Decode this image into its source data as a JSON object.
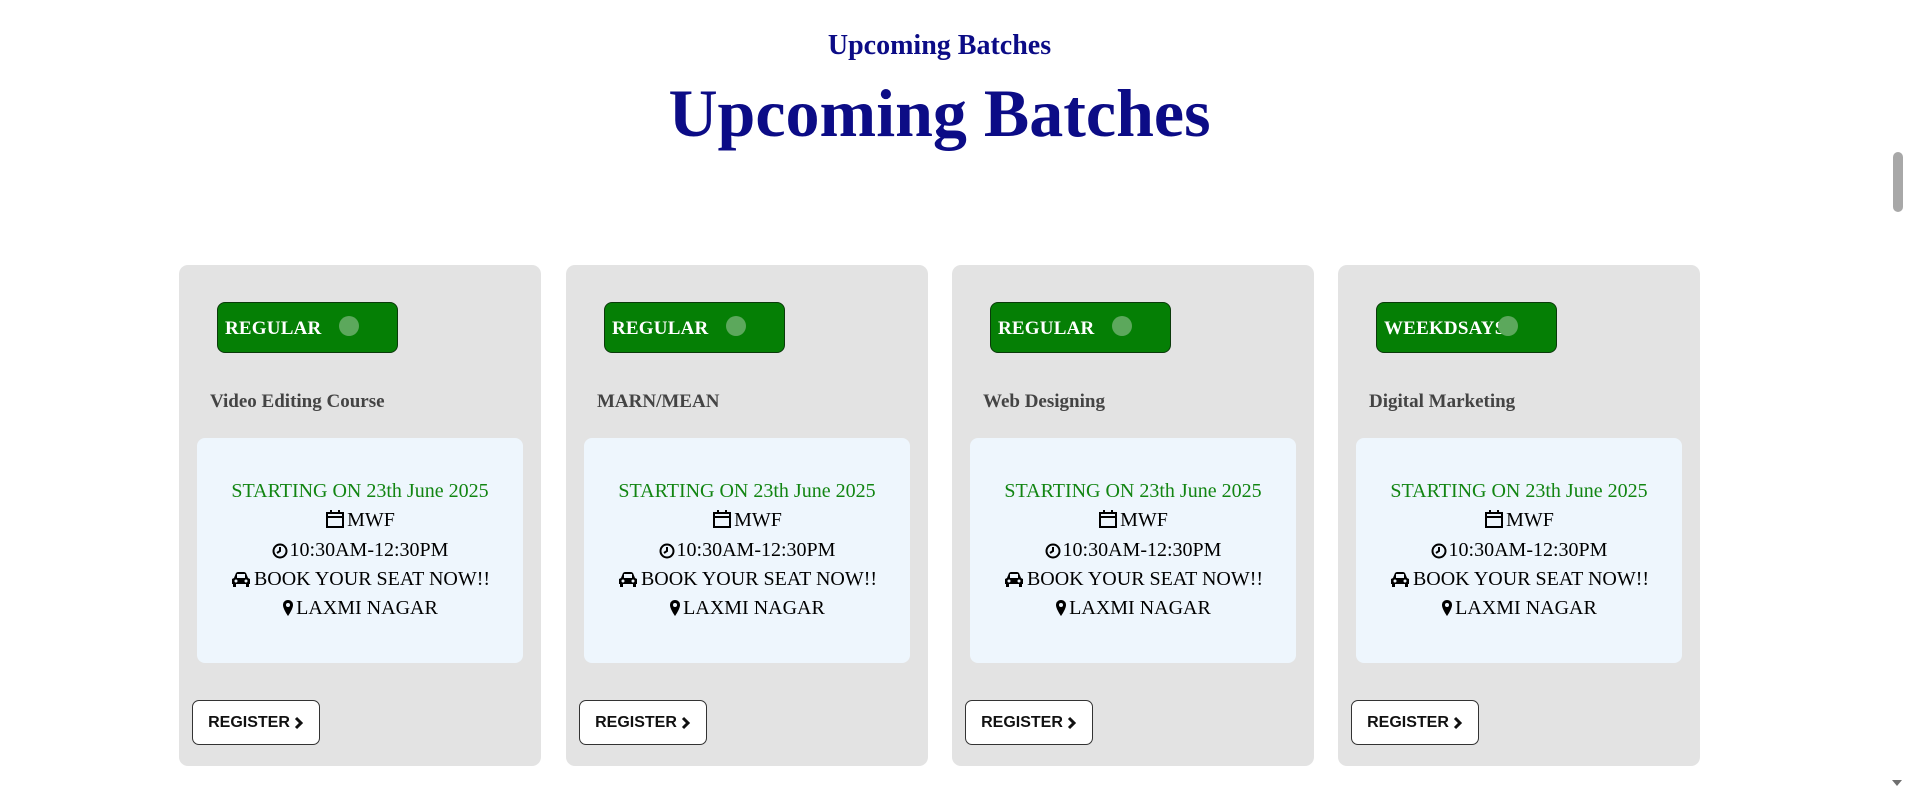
{
  "section": {
    "subheading": "Upcoming Batches",
    "heading": "Upcoming Batches"
  },
  "cards": [
    {
      "badge": "REGULAR",
      "course": "Video Editing Course",
      "starting": "STARTING ON 23th June 2025",
      "days": "MWF",
      "time": "10:30AM-12:30PM",
      "book": "BOOK YOUR SEAT NOW!!",
      "location": "LAXMI NAGAR",
      "button": "REGISTER"
    },
    {
      "badge": "REGULAR",
      "course": "MARN/MEAN",
      "starting": "STARTING ON 23th June 2025",
      "days": "MWF",
      "time": "10:30AM-12:30PM",
      "book": "BOOK YOUR SEAT NOW!!",
      "location": "LAXMI NAGAR",
      "button": "REGISTER"
    },
    {
      "badge": "REGULAR",
      "course": "Web Designing",
      "starting": "STARTING ON 23th June 2025",
      "days": "MWF",
      "time": "10:30AM-12:30PM",
      "book": "BOOK YOUR SEAT NOW!!",
      "location": "LAXMI NAGAR",
      "button": "REGISTER"
    },
    {
      "badge": "WEEKDSAYS",
      "course": "Digital Marketing",
      "starting": "STARTING ON 23th June 2025",
      "days": "MWF",
      "time": "10:30AM-12:30PM",
      "book": "BOOK YOUR SEAT NOW!!",
      "location": "LAXMI NAGAR",
      "button": "REGISTER"
    }
  ],
  "icons": {
    "days": "calendar-icon",
    "time": "clock-icon",
    "book": "car-icon",
    "location": "map-marker-icon",
    "button": "chevron-right-icon"
  },
  "colors": {
    "heading": "#0c0c86",
    "badge": "#057f05",
    "starting_text": "#128512",
    "card_bg": "#e3e3e3",
    "info_bg": "#eef6fd"
  }
}
